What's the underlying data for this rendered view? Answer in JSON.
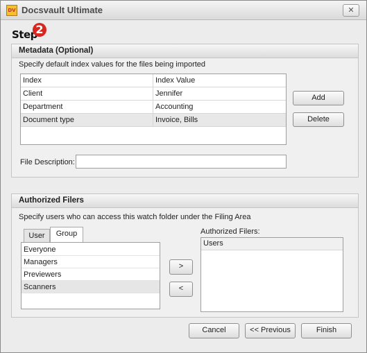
{
  "window": {
    "title": "Docsvault Ultimate",
    "icon_text": "DV",
    "close_glyph": "✕"
  },
  "step": {
    "word": "Step",
    "number": "2"
  },
  "metadata": {
    "heading": "Metadata (Optional)",
    "description": "Specify default index values for the files being imported",
    "columns": [
      "Index",
      "Index Value"
    ],
    "rows": [
      {
        "index": "Client",
        "value": "Jennifer"
      },
      {
        "index": "Department",
        "value": "Accounting"
      },
      {
        "index": "Document type",
        "value": "Invoice, Bills"
      }
    ],
    "add_label": "Add",
    "delete_label": "Delete",
    "file_description_label": "File Description:",
    "file_description_value": ""
  },
  "filers": {
    "heading": "Authorized Filers",
    "description": "Specify users who can access this watch folder under the Filing Area",
    "tabs": [
      "User",
      "Group"
    ],
    "active_tab": "Group",
    "groups": [
      "Everyone",
      "Managers",
      "Previewers",
      "Scanners"
    ],
    "selected_group": "Scanners",
    "add_arrow": ">",
    "remove_arrow": "<",
    "authorized_label": "Authorized Filers:",
    "authorized_column": "Users",
    "authorized_items": []
  },
  "footer": {
    "cancel_label": "Cancel",
    "previous_label": "<< Previous",
    "finish_label": "Finish"
  },
  "colors": {
    "step_accent": "#d7271f",
    "icon_bg": "#f2c12e"
  }
}
